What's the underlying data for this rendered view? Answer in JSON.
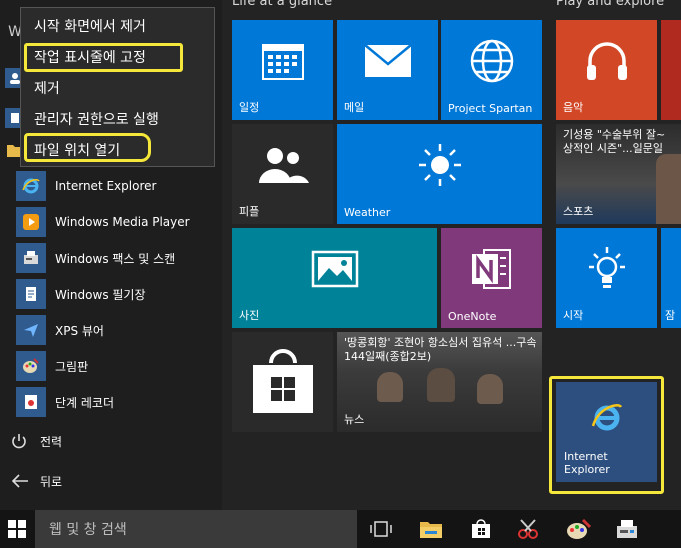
{
  "groups": {
    "left_title": "Life at a glance",
    "right_title": "Play and explore",
    "left_fragment": "W"
  },
  "context_menu": {
    "items": [
      "시작 화면에서 제거",
      "작업 표시줄에 고정",
      "제거",
      "관리자 권한으로 실행",
      "파일 위치 열기"
    ],
    "highlighted": [
      "작업 표시줄에 고정",
      "파일 위치 열기"
    ]
  },
  "apps": [
    {
      "label": "Internet Explorer",
      "icon": "ie-icon"
    },
    {
      "label": "Windows Media Player",
      "icon": "media-player-icon"
    },
    {
      "label": "Windows 팩스 및 스캔",
      "icon": "fax-scan-icon"
    },
    {
      "label": "Windows 필기장",
      "icon": "journal-icon"
    },
    {
      "label": "XPS 뷰어",
      "icon": "xps-icon"
    },
    {
      "label": "그림판",
      "icon": "paint-icon"
    },
    {
      "label": "단계 레코더",
      "icon": "recorder-icon"
    }
  ],
  "bottom": {
    "power": "전력",
    "back": "뒤로"
  },
  "tiles": {
    "calendar": "일정",
    "mail": "메일",
    "spartan": "Project Spartan",
    "music": "음악",
    "people": "피플",
    "weather": "Weather",
    "sports": "스포츠",
    "sports_headline": "기성용 \"수술부위 잘~ 상적인 시즌\"...일문일",
    "photos": "사진",
    "onenote": "OneNote",
    "tips": "시작",
    "partial_tile": "잠",
    "news": "뉴스",
    "news_headline": "'땅콩회항' 조현아 항소심서 집유석 ...구속 144일째(종합2보)",
    "ie_tile": "Internet Explorer"
  },
  "taskbar": {
    "search_placeholder": "웹 및 창 검색"
  },
  "colors": {
    "highlight": "#f5e83a",
    "tile_blue": "#0078d7",
    "tile_teal": "#008299",
    "tile_purple": "#80397b",
    "tile_orange": "#d24726",
    "tile_ie": "#2d4f7f"
  }
}
